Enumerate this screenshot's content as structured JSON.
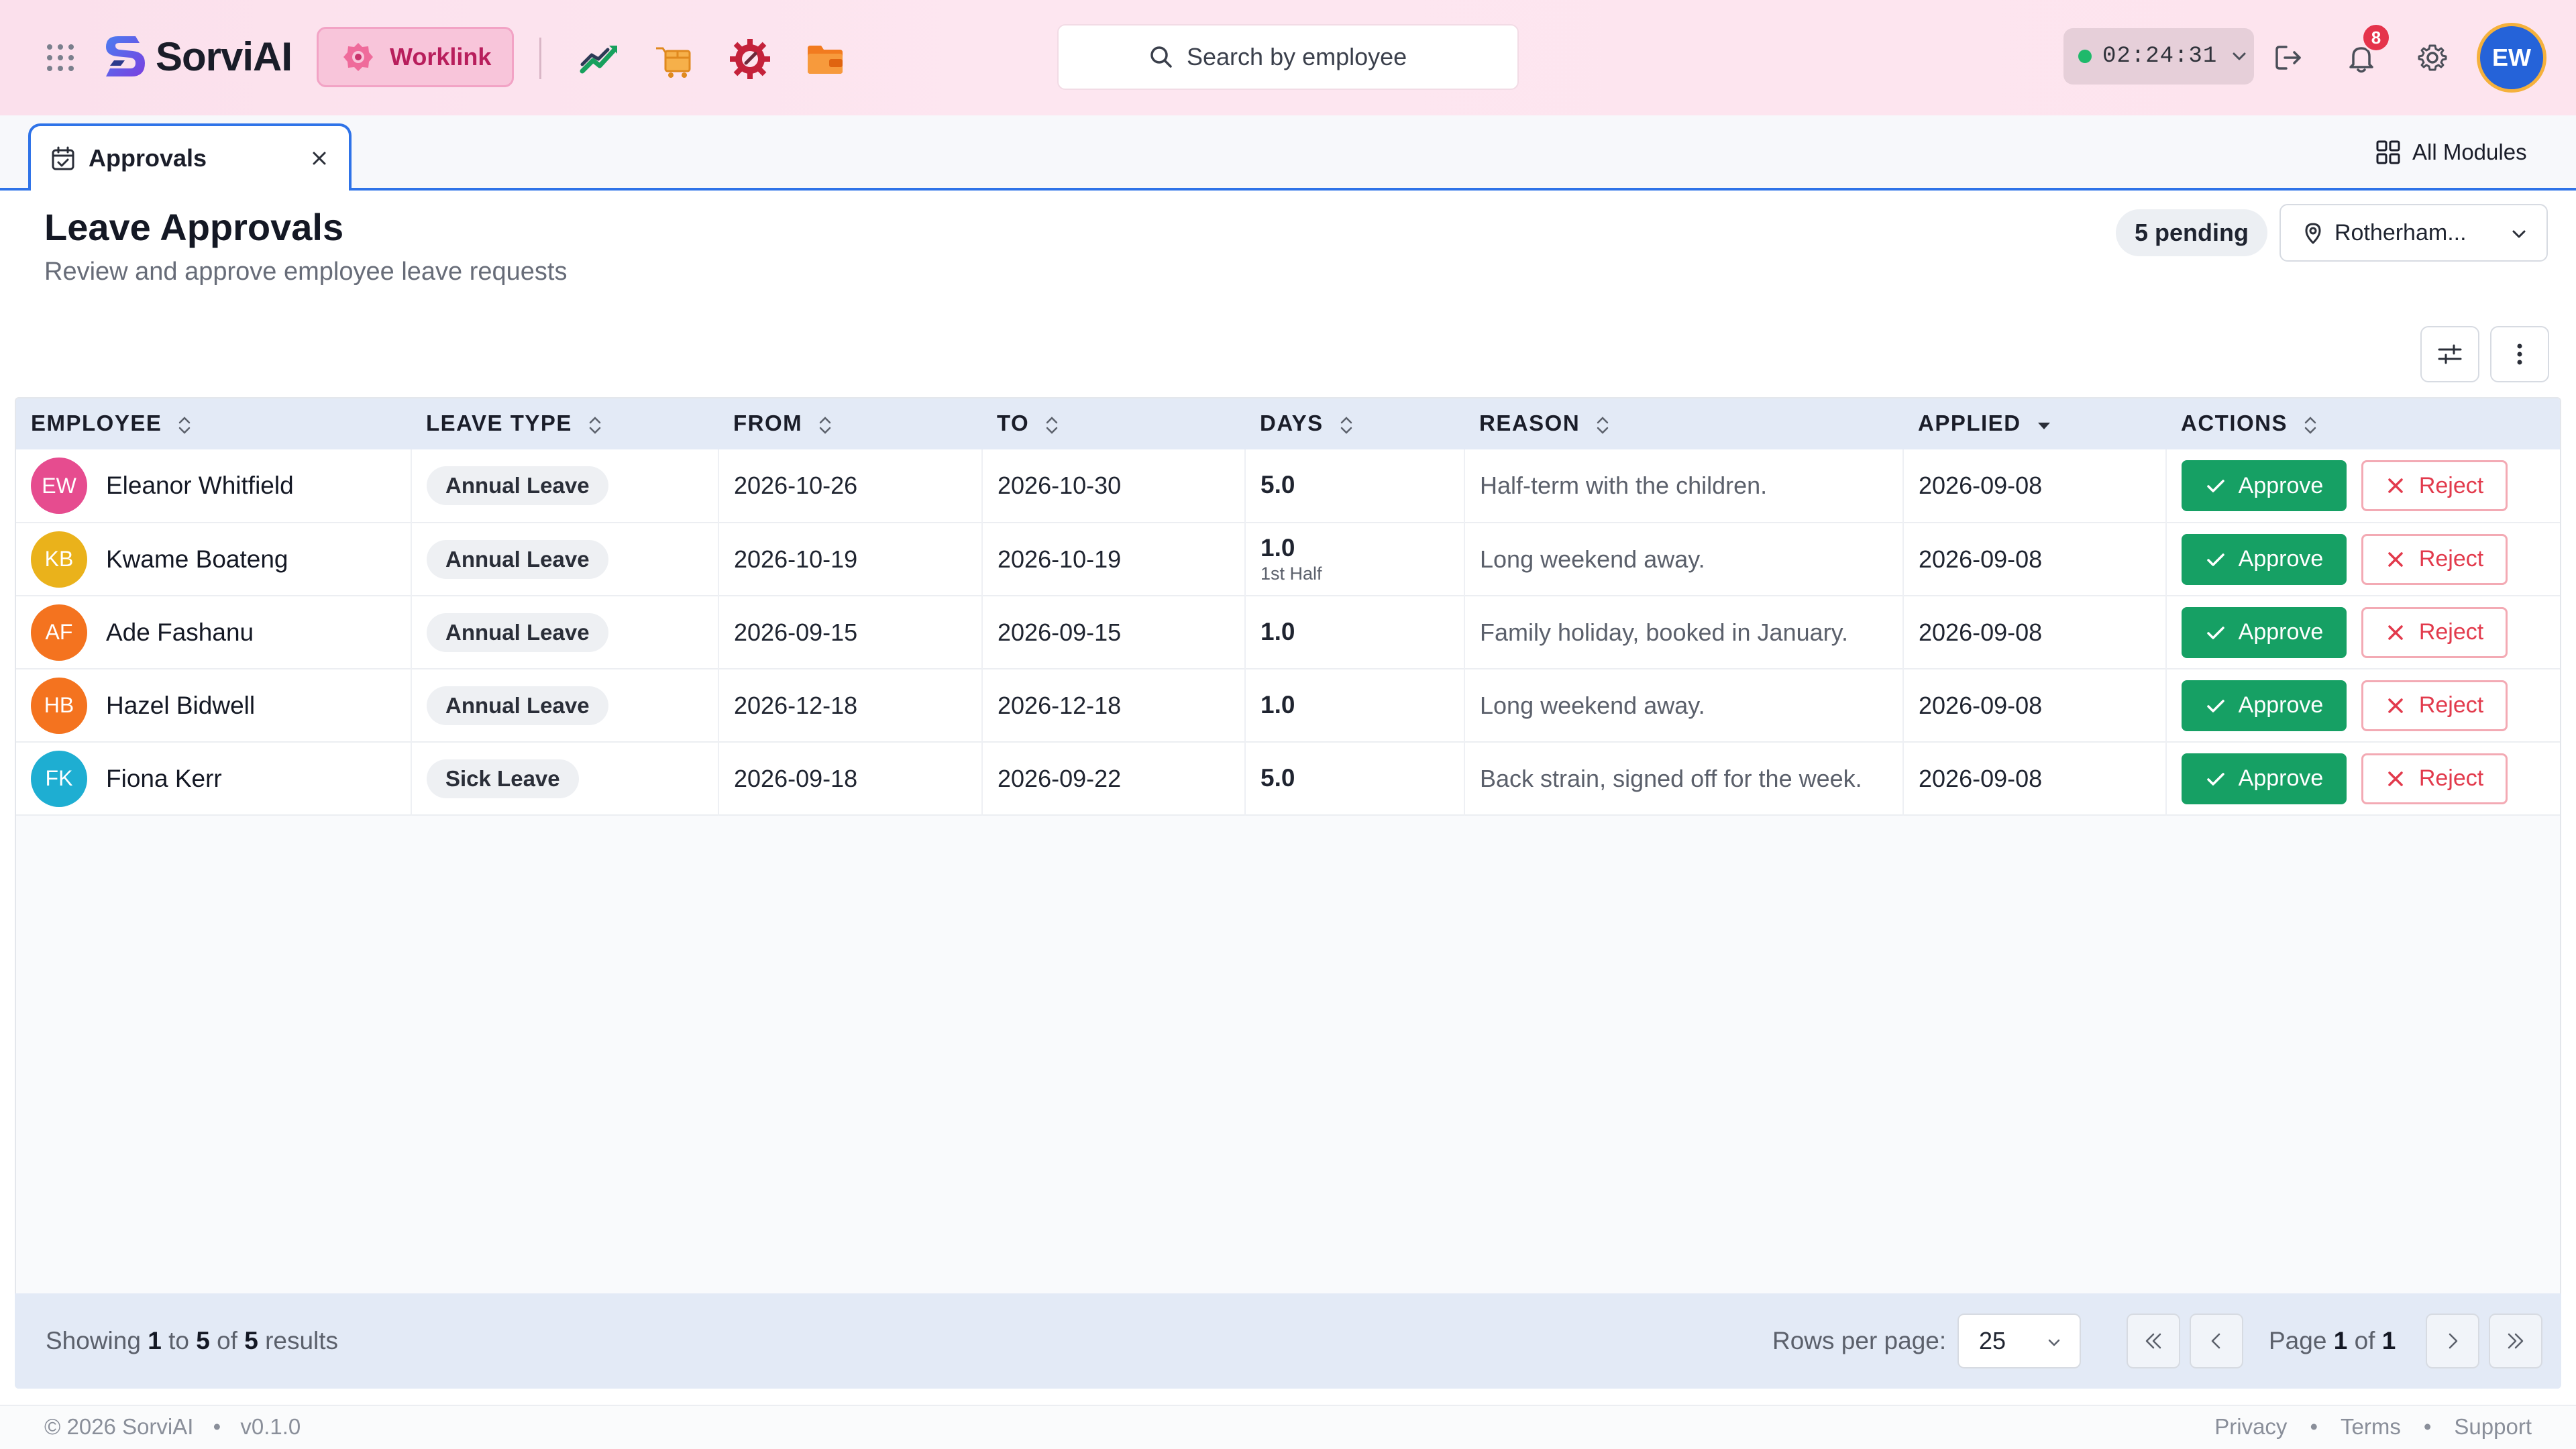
{
  "app": {
    "brand": "SorviAI",
    "worklink_label": "Worklink",
    "search_placeholder": "Search by employee",
    "timer": "02:24:31",
    "notifications_count": "8",
    "user_initials": "EW",
    "status_color": "#1fb96b",
    "accent_color": "#2f73e8"
  },
  "tabs": [
    {
      "label": "Approvals",
      "active": true
    }
  ],
  "all_modules_label": "All Modules",
  "page": {
    "title": "Leave Approvals",
    "subtitle": "Review and approve employee leave requests",
    "pending_label": "5 pending",
    "location": "Rotherham..."
  },
  "table": {
    "columns": [
      "EMPLOYEE",
      "LEAVE TYPE",
      "FROM",
      "TO",
      "DAYS",
      "REASON",
      "APPLIED",
      "ACTIONS"
    ],
    "sorted_column": "APPLIED",
    "approve_label": "Approve",
    "reject_label": "Reject",
    "rows": [
      {
        "initials": "EW",
        "avatar_color": "#e64c8f",
        "name": "Eleanor Whitfield",
        "leave_type": "Annual Leave",
        "from": "2026-10-26",
        "to": "2026-10-30",
        "days": "5.0",
        "days_note": "",
        "reason": "Half-term with the children.",
        "applied": "2026-09-08"
      },
      {
        "initials": "KB",
        "avatar_color": "#eab21b",
        "name": "Kwame Boateng",
        "leave_type": "Annual Leave",
        "from": "2026-10-19",
        "to": "2026-10-19",
        "days": "1.0",
        "days_note": "1st Half",
        "reason": "Long weekend away.",
        "applied": "2026-09-08"
      },
      {
        "initials": "AF",
        "avatar_color": "#f4731f",
        "name": "Ade Fashanu",
        "leave_type": "Annual Leave",
        "from": "2026-09-15",
        "to": "2026-09-15",
        "days": "1.0",
        "days_note": "",
        "reason": "Family holiday, booked in January.",
        "applied": "2026-09-08"
      },
      {
        "initials": "HB",
        "avatar_color": "#f4731f",
        "name": "Hazel Bidwell",
        "leave_type": "Annual Leave",
        "from": "2026-12-18",
        "to": "2026-12-18",
        "days": "1.0",
        "days_note": "",
        "reason": "Long weekend away.",
        "applied": "2026-09-08"
      },
      {
        "initials": "FK",
        "avatar_color": "#1eaed2",
        "name": "Fiona Kerr",
        "leave_type": "Sick Leave",
        "from": "2026-09-18",
        "to": "2026-09-22",
        "days": "5.0",
        "days_note": "",
        "reason": "Back strain, signed off for the week.",
        "applied": "2026-09-08"
      }
    ]
  },
  "pagination": {
    "showing_prefix": "Showing",
    "range_start": "1",
    "to_word": "to",
    "range_end": "5",
    "of_word": "of",
    "total": "5",
    "results_word": "results",
    "rows_per_page_label": "Rows per page:",
    "rows_per_page": "25",
    "page_word": "Page",
    "current_page": "1",
    "total_pages": "1"
  },
  "footer": {
    "copyright": "© 2026 SorviAI",
    "version": "v0.1.0",
    "links": [
      "Privacy",
      "Terms",
      "Support"
    ]
  }
}
